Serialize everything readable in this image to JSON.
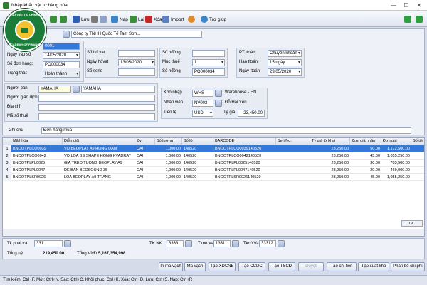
{
  "window": {
    "title": "Nhập khẩu vật tư hàng hóa",
    "controls": [
      "—",
      "☐",
      "✕"
    ]
  },
  "toolbar": {
    "save": "Lưu",
    "load": "Nạp",
    "reset": "Lại",
    "delete": "Xóa",
    "import": "Import",
    "help": "Trợ giúp"
  },
  "logo": {
    "text_top": "SỐ VIỆT TÀI CHÍNH",
    "text_bottom": "ACADEMY OF FINANCE"
  },
  "header": {
    "vendor_code_label": "Đơ",
    "vendor_name": "Công ty TNHH Quốc Tế Tam Sơn...",
    "so_ct_label": "Số ct",
    "so_ct_value": "0001",
    "ngay_vao_so_label": "Ngày vào số",
    "ngay_vao_so_value": "14/05/2020",
    "so_don_hang_label": "Số đơn hàng:",
    "so_don_hang_value": "PO000034",
    "trang_thai_label": "Trạng thái:",
    "trang_thai_value": "Hoàn thành",
    "so_hd_vat_label": "Số hđ vat",
    "so_hd_vat_value": "",
    "ngay_hdvat_label": "Ngày hđvat",
    "ngay_hdvat_value": "13/05/2020",
    "so_serie_label": "Số serie",
    "so_serie_value": "",
    "so_hopdong_label": "Số hđồng",
    "so_hopdong_value": "",
    "muc_thue_label": "Mục thuế",
    "muc_thue_value": "1.",
    "so_hopdong2_label": "Số hđồng:",
    "so_hopdong2_value": "PO000034",
    "pt_ttoan_label": "PT ttoán:",
    "pt_ttoan_value": "Chuyển khoản",
    "han_ttoan_label": "Hạn ttoán:",
    "han_ttoan_value": "15 ngày",
    "ngay_ttoan_label": "Ngày ttoán",
    "ngay_ttoan_value": "29/05/2020",
    "nguoi_ban_label": "Người bán",
    "nguoi_ban_code": "YAMAHA",
    "nguoi_ban_name": "YAMAHA",
    "nguoi_giao_dich_label": "Người giao dịch",
    "dia_chi_label": "Địa chỉ",
    "ma_so_thue_label": "Mã số thuế",
    "kho_nhap_label": "Kho nhập",
    "kho_nhap_code": "WHS",
    "kho_nhap_name": "Warehouse - HN",
    "nhan_vien_label": "Nhân viên",
    "nhan_vien_code": "NV003",
    "nhan_vien_name": "Đỗ Hải Yến",
    "tien_te_label": "Tiền tệ",
    "tien_te_value": "USD",
    "ty_gia_label": "Tỷ giá",
    "ty_gia_value": "23,450.00",
    "ghi_chu_label": "Ghi chú",
    "ghi_chu_value": "Đơn hàng mua"
  },
  "grid": {
    "columns": [
      "Mã hhóa",
      "Diễn giải",
      "Đvt",
      "Số lượng",
      "Số lô",
      "BARCODE",
      "Seri No.",
      "Tỷ giá tờ khai",
      "Đơn giá nhập",
      "Đơn giá",
      "Số tiền"
    ],
    "rows": [
      {
        "num": "1",
        "code": "BNOOTPLCO0039",
        "desc": "VO BEOPLAY A9 HONG DAM",
        "unit": "CAI",
        "qty": "1,000.00",
        "lot": "140520",
        "barcode": "BNOOTPLCO0039140520",
        "seri": "",
        "rate": "23,250.00",
        "price_in": "50.00",
        "price": "1,172,500.00"
      },
      {
        "num": "2",
        "code": "BNOOTPLCO0042",
        "desc": "VO LOA BS SHAPE HONG KVADRAT",
        "unit": "CAI",
        "qty": "1,000.00",
        "lot": "140520",
        "barcode": "BNOOTPLCO0042140520",
        "seri": "",
        "rate": "23,250.00",
        "price_in": "45.00",
        "price": "1,055,250.00"
      },
      {
        "num": "3",
        "code": "BNOOTPLPL0025",
        "desc": "GIA TREO TUONG BEOPLAY A9",
        "unit": "CAI",
        "qty": "1,000.00",
        "lot": "140520",
        "barcode": "BNOOTPLPL0025140520",
        "seri": "",
        "rate": "23,250.00",
        "price_in": "30.00",
        "price": "703,500.00"
      },
      {
        "num": "4",
        "code": "BNOOTPLPL0047",
        "desc": "DE BAN BEOSOUND 35",
        "unit": "CAI",
        "qty": "1,000.00",
        "lot": "140520",
        "barcode": "BNOOTPLPL0047140520",
        "seri": "",
        "rate": "23,250.00",
        "price_in": "20.00",
        "price": "469,000.00"
      },
      {
        "num": "5",
        "code": "BNOOTPLSR0026",
        "desc": "LOA BEOPLAY A9 TRANG",
        "unit": "CAI",
        "qty": "1,000.00",
        "lot": "140520",
        "barcode": "BNOOTPLSR0026140520",
        "seri": "",
        "rate": "23,250.00",
        "price_in": "45.00",
        "price": "1,055,250.00"
      }
    ],
    "pager": "19..."
  },
  "footer": {
    "tk_phai_tra_label": "Tk phải trả",
    "tk_phai_tra_value": "331",
    "tk_nk_label": "TK NK",
    "tk_nk_value": "3333",
    "tkno_vat_label": "Tkno Vat",
    "tkno_vat_value": "1331",
    "tkco_vat_label": "Tkcó Vat",
    "tkco_vat_value": "33312",
    "tong_ne_label": "Tổng nệ",
    "tong_ne_value": "219,450.00",
    "tong_vnd_label": "Tổng VNĐ",
    "tong_vnd_value": "5,167,354,998"
  },
  "actions": [
    "In mã vạch",
    "Mã vạch",
    "Tạo XDCNB",
    "Tạo CCDC",
    "Tạo TSCĐ",
    "Duyệt",
    "Tạo chi tiền",
    "Tạo xuất kho",
    "Phân bổ chi phí"
  ],
  "status": "Tìm kiếm: Ctrl+F, Mới: Ctrl+N, Sao: Ctrl+C, Khôi phục: Ctrl+K, Xóa: Ctrl+D, Lưu: Ctrl+S, Nạp: Ctrl+R",
  "colors": {
    "selection": "#3478d9",
    "accent_green": "#2e7d32"
  }
}
